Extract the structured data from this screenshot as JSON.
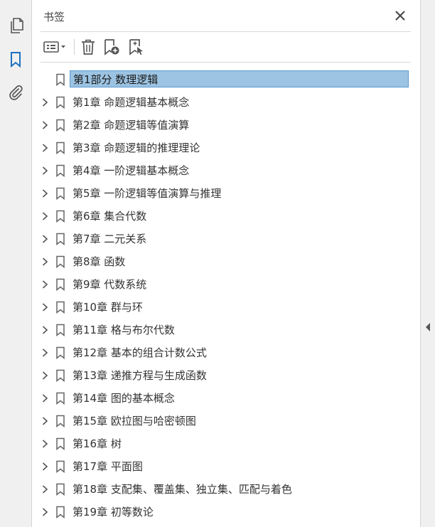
{
  "left_rail": {
    "items": [
      {
        "icon": "pages-icon",
        "active": false
      },
      {
        "icon": "bookmark-icon",
        "active": true
      },
      {
        "icon": "attachment-icon",
        "active": false
      }
    ]
  },
  "panel": {
    "title": "书签",
    "toolbar": {
      "options_icon": "options-menu-icon",
      "delete_icon": "trash-icon",
      "new_bookmark_icon": "new-bookmark-icon",
      "from_structure_icon": "bookmark-from-structure-icon"
    }
  },
  "bookmarks": [
    {
      "label": "第1部分  数理逻辑",
      "expandable": false,
      "selected": true
    },
    {
      "label": "第1章  命题逻辑基本概念",
      "expandable": true,
      "selected": false
    },
    {
      "label": "第2章  命题逻辑等值演算",
      "expandable": true,
      "selected": false
    },
    {
      "label": "第3章  命题逻辑的推理理论",
      "expandable": true,
      "selected": false
    },
    {
      "label": "第4章  一阶逻辑基本概念",
      "expandable": true,
      "selected": false
    },
    {
      "label": "第5章  一阶逻辑等值演算与推理",
      "expandable": true,
      "selected": false
    },
    {
      "label": "第6章  集合代数",
      "expandable": true,
      "selected": false
    },
    {
      "label": "第7章  二元关系",
      "expandable": true,
      "selected": false
    },
    {
      "label": "第8章  函数",
      "expandable": true,
      "selected": false
    },
    {
      "label": "第9章  代数系统",
      "expandable": true,
      "selected": false
    },
    {
      "label": "第10章  群与环",
      "expandable": true,
      "selected": false
    },
    {
      "label": "第11章  格与布尔代数",
      "expandable": true,
      "selected": false
    },
    {
      "label": "第12章  基本的组合计数公式",
      "expandable": true,
      "selected": false
    },
    {
      "label": "第13章  递推方程与生成函数",
      "expandable": true,
      "selected": false
    },
    {
      "label": "第14章  图的基本概念",
      "expandable": true,
      "selected": false
    },
    {
      "label": "第15章  欧拉图与哈密顿图",
      "expandable": true,
      "selected": false
    },
    {
      "label": "第16章  树",
      "expandable": true,
      "selected": false
    },
    {
      "label": "第17章  平面图",
      "expandable": true,
      "selected": false
    },
    {
      "label": "第18章  支配集、覆盖集、独立集、匹配与着色",
      "expandable": true,
      "selected": false
    },
    {
      "label": "第19章  初等数论",
      "expandable": true,
      "selected": false
    }
  ],
  "colors": {
    "accent": "#1f6fbf",
    "selection_bg": "#9cc3e2",
    "selection_border": "#5a9ad0"
  }
}
